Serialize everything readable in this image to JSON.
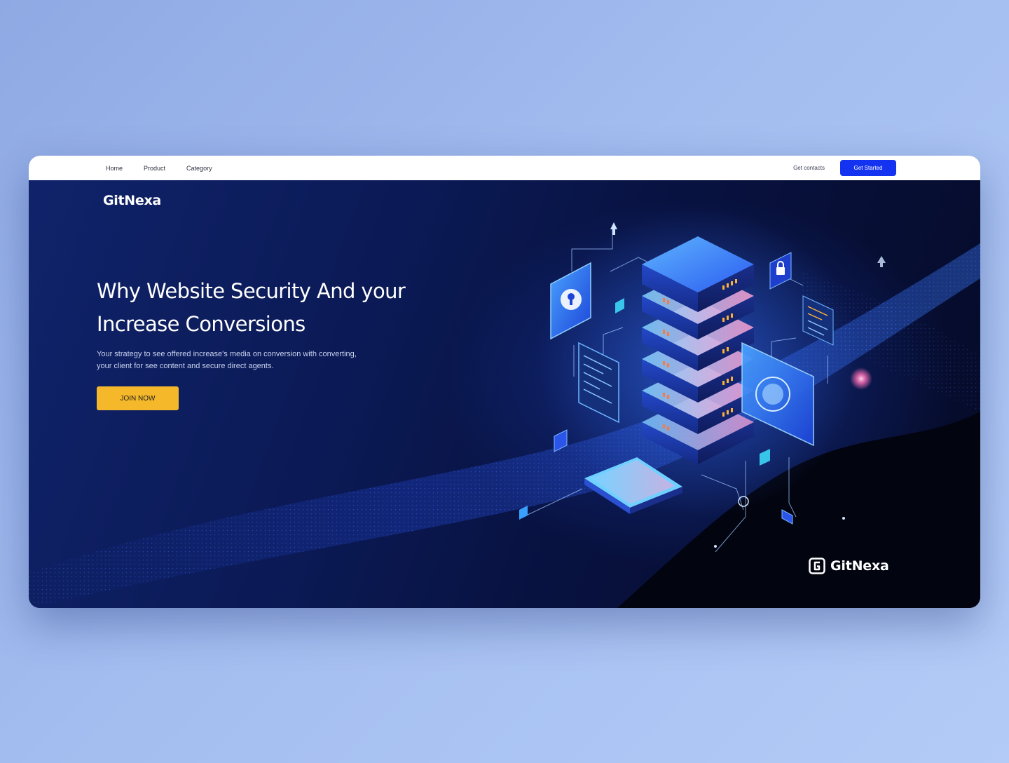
{
  "nav": {
    "links": [
      "Home",
      "Product",
      "Category"
    ],
    "secondary_label": "Get contacts",
    "cta_label": "Get Started"
  },
  "hero": {
    "brand": "GitNexa",
    "title_line1": "Why Website Security And your",
    "title_line2": "Increase Conversions",
    "description_line1": "Your strategy to see offered increase's media on conversion with converting,",
    "description_line2": "your client for see content and secure direct agents.",
    "cta_label": "JOIN NOW"
  },
  "footer_logo": {
    "text": "GitNexa",
    "icon": "gitnexa-logo-icon"
  },
  "colors": {
    "page_background": "#a3bdf0",
    "hero_background": "#0b1a56",
    "nav_background": "#ffffff",
    "nav_cta": "#1433f0",
    "hero_cta": "#f5b82a",
    "accent_glow": "#3aa0ff"
  }
}
